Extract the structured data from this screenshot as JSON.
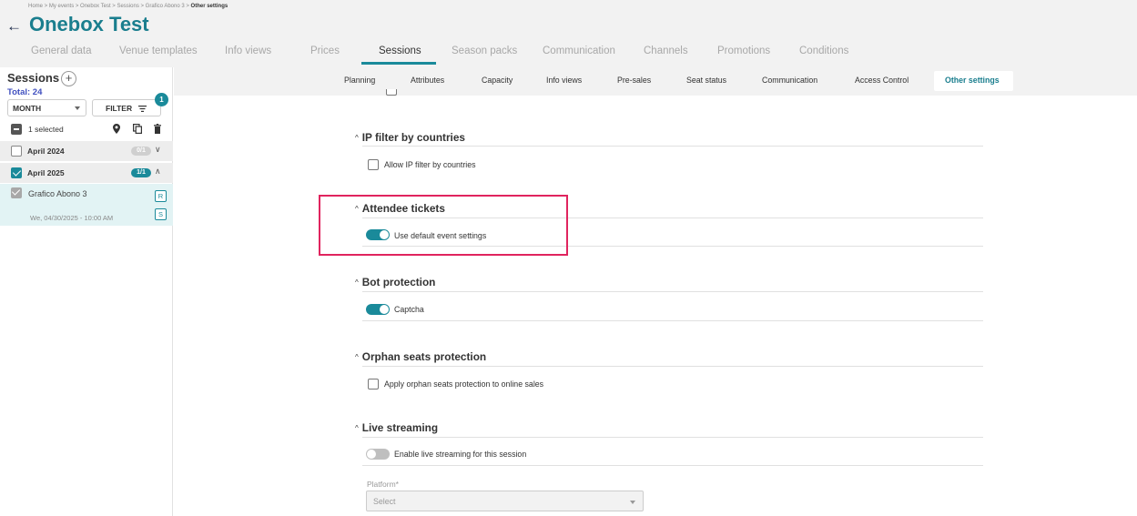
{
  "header": {
    "breadcrumb": [
      "Home",
      "My events",
      "Onebox Test",
      "Sessions",
      "Grafico Abono 3"
    ],
    "breadcrumb_current": "Other settings",
    "breadcrumb_sep": " > ",
    "back_icon": "arrow-left-icon",
    "title": "Onebox Test",
    "tabs": [
      {
        "label": "General data"
      },
      {
        "label": "Venue templates"
      },
      {
        "label": "Info views"
      },
      {
        "label": "Prices"
      },
      {
        "label": "Sessions",
        "active": true
      },
      {
        "label": "Season packs"
      },
      {
        "label": "Communication"
      },
      {
        "label": "Channels"
      },
      {
        "label": "Promotions"
      },
      {
        "label": "Conditions"
      }
    ]
  },
  "sidebar": {
    "title": "Sessions",
    "add_label": "+",
    "total": "Total: 24",
    "month_select": "MONTH",
    "filter_label": "FILTER",
    "filter_badge": "1",
    "selected_text": "1 selected",
    "selection_icons": [
      "map-pin-icon",
      "copy-icon",
      "trash-icon"
    ],
    "months": [
      {
        "label": "April 2024",
        "count": "0/1",
        "checked": false,
        "chevron": "∨"
      },
      {
        "label": "April 2025",
        "count": "1/1",
        "checked": true,
        "chevron": "∧"
      }
    ],
    "session": {
      "name": "Grafico Abono 3",
      "date": "We, 04/30/2025 - 10:00 AM",
      "tags": [
        "R",
        "S"
      ]
    }
  },
  "subtabs": [
    {
      "label": "Planning"
    },
    {
      "label": "Attributes"
    },
    {
      "label": "Capacity"
    },
    {
      "label": "Info views"
    },
    {
      "label": "Pre-sales"
    },
    {
      "label": "Seat status"
    },
    {
      "label": "Communication"
    },
    {
      "label": "Access Control"
    },
    {
      "label": "Other settings",
      "active": true
    }
  ],
  "sections": {
    "ip_filter": {
      "title": "IP filter by countries",
      "option": "Allow IP filter by countries",
      "checked": false
    },
    "attendee": {
      "title": "Attendee tickets",
      "option": "Use default event settings",
      "toggle_on": true
    },
    "bot": {
      "title": "Bot protection",
      "option": "Captcha",
      "toggle_on": true
    },
    "orphan": {
      "title": "Orphan seats protection",
      "option": "Apply orphan seats protection to online sales",
      "checked": false
    },
    "live": {
      "title": "Live streaming",
      "option": "Enable live streaming for this session",
      "toggle_on": false,
      "platform_label": "Platform*",
      "platform_placeholder": "Select"
    }
  },
  "colors": {
    "brand": "#1a7e8e",
    "accent": "#1a8a9a",
    "highlight": "#e0245e",
    "total_text": "#3f4fbf"
  }
}
